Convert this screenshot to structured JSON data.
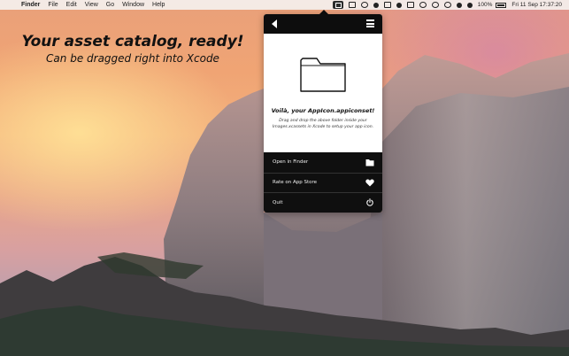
{
  "menubar": {
    "apple": "",
    "items": [
      "Finder",
      "File",
      "Edit",
      "View",
      "Go",
      "Window",
      "Help"
    ],
    "battery_percent": "100%",
    "datetime": "Fri 11 Sep  17:37:20"
  },
  "promo": {
    "headline": "Your asset catalog, ready!",
    "subline": "Can be dragged right into Xcode"
  },
  "popover": {
    "title": "Voilà, your AppIcon.appiconset!",
    "description": "Drag and drop the above folder inside your Images.xcassets in Xcode to setup your app icon.",
    "actions": [
      {
        "label": "Open in Finder",
        "icon": "folder-icon"
      },
      {
        "label": "Rate on App Store",
        "icon": "heart-icon"
      },
      {
        "label": "Quit",
        "icon": "power-icon"
      }
    ]
  },
  "colors": {
    "popover_dark": "#0d0d0d",
    "menubar": "#f4f0ee"
  }
}
